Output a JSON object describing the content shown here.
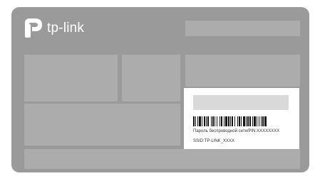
{
  "label": {
    "brand": "tp-link",
    "logo_icon": "tp-link-logo-icon",
    "background_color": "#9a9a9a",
    "panel_color": "#acacac"
  },
  "sticker": {
    "pin_line": "Пароль беспроводной сети/PIN:XXXXXXXX",
    "ssid_line": "SSID:TP-LINK_XXXX",
    "barcode_icon": "barcode-icon"
  }
}
